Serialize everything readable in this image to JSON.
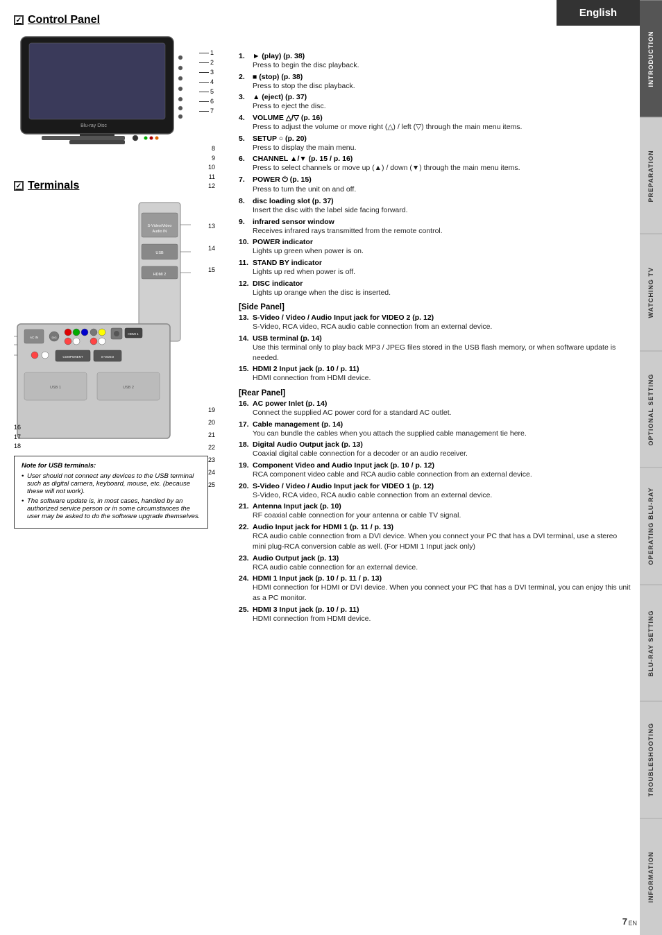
{
  "header": {
    "language": "English"
  },
  "page_number": "7",
  "page_suffix": "EN",
  "side_tabs": [
    {
      "id": "introduction",
      "label": "INTRODUCTION",
      "active": true
    },
    {
      "id": "preparation",
      "label": "PREPARATION",
      "active": false
    },
    {
      "id": "watching_tv",
      "label": "WATCHING TV",
      "active": false
    },
    {
      "id": "optional_setting",
      "label": "OPTIONAL SETTING",
      "active": false
    },
    {
      "id": "operating_bluray",
      "label": "OPERATING BLU-RAY",
      "active": false
    },
    {
      "id": "bluray_setting",
      "label": "BLU-RAY SETTING",
      "active": false
    },
    {
      "id": "troubleshooting",
      "label": "TROUBLESHOOTING",
      "active": false
    },
    {
      "id": "information",
      "label": "INFORMATION",
      "active": false
    }
  ],
  "control_panel": {
    "title": "Control Panel",
    "items": [
      {
        "num": "1.",
        "title": "► (play) (p. 38)",
        "desc": "Press to begin the disc playback."
      },
      {
        "num": "2.",
        "title": "■ (stop) (p. 38)",
        "desc": "Press to stop the disc playback."
      },
      {
        "num": "3.",
        "title": "▲ (eject) (p. 37)",
        "desc": "Press to eject the disc."
      },
      {
        "num": "4.",
        "title": "VOLUME △/▽ (p. 16)",
        "desc": "Press to adjust the volume or move right (△) / left (▽) through the main menu items."
      },
      {
        "num": "5.",
        "title": "SETUP ○ (p. 20)",
        "desc": "Press to display the main menu."
      },
      {
        "num": "6.",
        "title": "CHANNEL ▲/▼ (p. 15 / p. 16)",
        "desc": "Press to select channels or move up (▲) / down (▼) through the main menu items."
      },
      {
        "num": "7.",
        "title": "POWER ⏻ (p. 15)",
        "desc": "Press to turn the unit on and off."
      },
      {
        "num": "8.",
        "title": "disc loading slot (p. 37)",
        "desc": "Insert the disc with the label side facing forward."
      },
      {
        "num": "9.",
        "title": "infrared sensor window",
        "desc": "Receives infrared rays transmitted from the remote control."
      },
      {
        "num": "10.",
        "title": "POWER indicator",
        "desc": "Lights up green when power is on."
      },
      {
        "num": "11.",
        "title": "STAND BY indicator",
        "desc": "Lights up red when power is off."
      },
      {
        "num": "12.",
        "title": "DISC indicator",
        "desc": "Lights up orange when the disc is inserted."
      }
    ],
    "callout_numbers": [
      "1",
      "2",
      "3",
      "4",
      "5",
      "6",
      "7",
      "8",
      "9",
      "10",
      "11",
      "12"
    ]
  },
  "terminals": {
    "title": "Terminals",
    "side_panel_label": "[Side Panel]",
    "rear_panel_label": "[Rear Panel]",
    "items": [
      {
        "num": "13.",
        "title": "S-Video / Video / Audio Input jack for VIDEO 2 (p. 12)",
        "desc": "S-Video, RCA video, RCA audio cable connection from an external device."
      },
      {
        "num": "14.",
        "title": "USB terminal (p. 14)",
        "desc": "Use this terminal only to play back MP3 / JPEG files stored in the USB flash memory, or when software update is needed."
      },
      {
        "num": "15.",
        "title": "HDMI 2 Input jack (p. 10 / p. 11)",
        "desc": "HDMI connection from HDMI device."
      },
      {
        "num": "16.",
        "title": "AC power Inlet (p. 14)",
        "desc": "Connect the supplied AC power cord for a standard AC outlet."
      },
      {
        "num": "17.",
        "title": "Cable management (p. 14)",
        "desc": "You can bundle the cables when you attach the supplied cable management tie here."
      },
      {
        "num": "18.",
        "title": "Digital Audio Output jack (p. 13)",
        "desc": "Coaxial digital cable connection for a decoder or an audio receiver."
      },
      {
        "num": "19.",
        "title": "Component Video and Audio Input jack (p. 10 / p. 12)",
        "desc": "RCA component video cable and RCA audio cable connection from an external device."
      },
      {
        "num": "20.",
        "title": "S-Video / Video / Audio Input jack for VIDEO 1 (p. 12)",
        "desc": "S-Video, RCA video, RCA audio cable connection from an external device."
      },
      {
        "num": "21.",
        "title": "Antenna Input jack (p. 10)",
        "desc": "RF coaxial cable connection for your antenna or cable TV signal."
      },
      {
        "num": "22.",
        "title": "Audio Input jack for HDMI 1 (p. 11 / p. 13)",
        "desc": "RCA audio cable connection from a DVI device. When you connect your PC that has a DVI terminal, use a stereo mini plug-RCA conversion cable as well. (For HDMI 1 Input jack only)"
      },
      {
        "num": "23.",
        "title": "Audio Output jack (p. 13)",
        "desc": "RCA audio cable connection for an external device."
      },
      {
        "num": "24.",
        "title": "HDMI 1 Input jack (p. 10 / p. 11 / p. 13)",
        "desc": "HDMI connection for HDMI or DVI device. When you connect your PC that has a DVI terminal, you can enjoy this unit as a PC monitor."
      },
      {
        "num": "25.",
        "title": "HDMI 3 Input jack (p. 10 / p. 11)",
        "desc": "HDMI connection from HDMI device."
      }
    ],
    "callout_numbers_side": [
      "13",
      "14",
      "15"
    ],
    "callout_numbers_rear": [
      "16",
      "17",
      "18",
      "19",
      "20",
      "21",
      "22",
      "23",
      "24",
      "25"
    ],
    "note": {
      "title": "Note for USB terminals:",
      "items": [
        "User should not connect any devices to the USB terminal such as digital camera, keyboard, mouse, etc. (because these will not work).",
        "The software update is, in most cases, handled by an authorized service person or in some circumstances the user may be asked to do the software upgrade themselves."
      ]
    }
  }
}
